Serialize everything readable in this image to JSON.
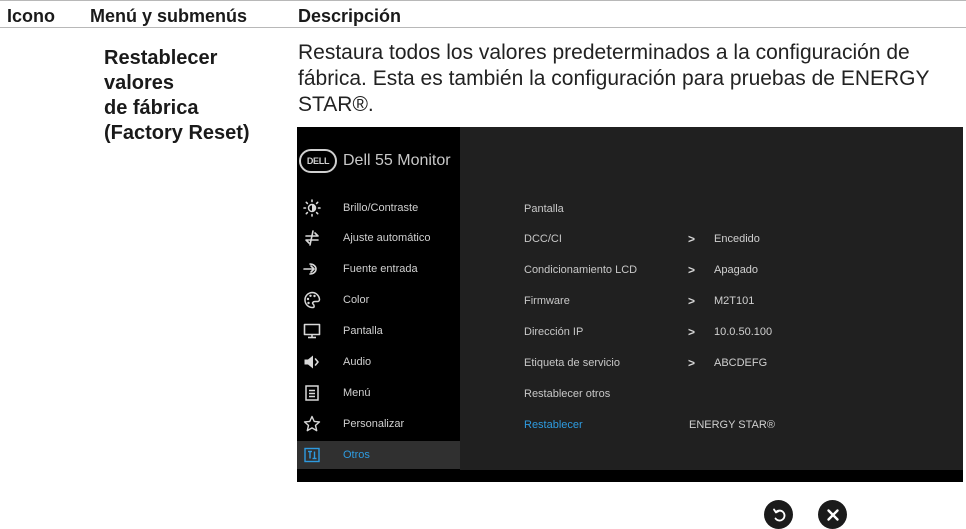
{
  "table": {
    "headers": {
      "icon": "Icono",
      "menu": "Menú y submenús",
      "description": "Descripción"
    },
    "row": {
      "submenu_lines": [
        "Restablecer",
        "valores",
        "de fábrica",
        "(Factory Reset)"
      ],
      "description": "Restaura todos los valores predeterminados a la configuración de fábrica. Esta es también la configuración para pruebas de ENERGY STAR®."
    }
  },
  "osd": {
    "brand_logo": "DELL",
    "model": "Dell 55 Monitor",
    "accent_color": "#2e9be0",
    "menu": [
      {
        "label": "Brillo/Contraste",
        "icon": "brightness-icon"
      },
      {
        "label": "Ajuste automático",
        "icon": "auto-adjust-icon"
      },
      {
        "label": "Fuente entrada",
        "icon": "input-source-icon"
      },
      {
        "label": "Color",
        "icon": "palette-icon"
      },
      {
        "label": "Pantalla",
        "icon": "monitor-icon"
      },
      {
        "label": "Audio",
        "icon": "speaker-icon"
      },
      {
        "label": "Menú",
        "icon": "menu-doc-icon"
      },
      {
        "label": "Personalizar",
        "icon": "star-icon"
      },
      {
        "label": "Otros",
        "icon": "others-icon",
        "active": true
      }
    ],
    "options": [
      {
        "label": "Pantalla",
        "value": ""
      },
      {
        "label": "DCC/CI",
        "value": "Encedido"
      },
      {
        "label": "Condicionamiento LCD",
        "value": "Apagado"
      },
      {
        "label": "Firmware",
        "value": "M2T101"
      },
      {
        "label": "Dirección IP",
        "value": "10.0.50.100"
      },
      {
        "label": "Etiqueta de servicio",
        "value": "ABCDEFG"
      },
      {
        "label": "Restablecer otros",
        "value": ""
      },
      {
        "label": "Restablecer",
        "value": "ENERGY STAR®",
        "selected": true
      }
    ],
    "chevron": ">"
  },
  "buttons": {
    "back": "back-icon",
    "close": "close-icon"
  }
}
